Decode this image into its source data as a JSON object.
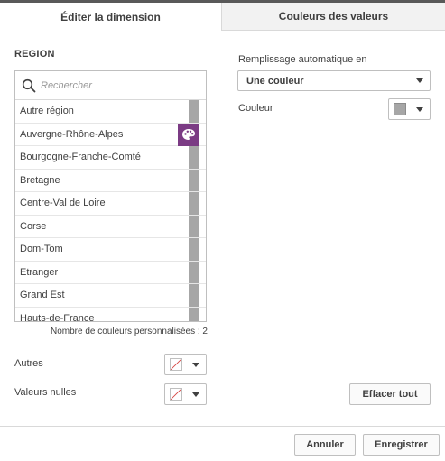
{
  "tabs": [
    {
      "label": "Éditer la dimension",
      "active": false
    },
    {
      "label": "Couleurs des valeurs",
      "active": true
    }
  ],
  "left": {
    "field_name": "REGION",
    "search_placeholder": "Rechercher",
    "items": [
      {
        "label": "Autre région",
        "custom_color": false
      },
      {
        "label": "Auvergne-Rhône-Alpes",
        "custom_color": true,
        "color": "#7b3b84"
      },
      {
        "label": "Bourgogne-Franche-Comté",
        "custom_color": false
      },
      {
        "label": "Bretagne",
        "custom_color": false
      },
      {
        "label": "Centre-Val de Loire",
        "custom_color": false
      },
      {
        "label": "Corse",
        "custom_color": false
      },
      {
        "label": "Dom-Tom",
        "custom_color": false
      },
      {
        "label": "Etranger",
        "custom_color": false
      },
      {
        "label": "Grand Est",
        "custom_color": false
      },
      {
        "label": "Hauts-de-France",
        "custom_color": false
      }
    ],
    "default_color": "#a6a6a6",
    "custom_count_text": "Nombre de couleurs personnalisées : 2",
    "others_label": "Autres",
    "nulls_label": "Valeurs nulles"
  },
  "right": {
    "autofill_label": "Remplissage automatique en",
    "autofill_value": "Une couleur",
    "color_label": "Couleur",
    "color_value": "#a6a6a6",
    "clear_button": "Effacer tout"
  },
  "footer": {
    "cancel_button": "Annuler",
    "save_button": "Enregistrer"
  },
  "colors": {
    "accent_purple": "#7b3b84",
    "default_gray": "#a6a6a6",
    "no_color_stroke": "#d64541"
  }
}
